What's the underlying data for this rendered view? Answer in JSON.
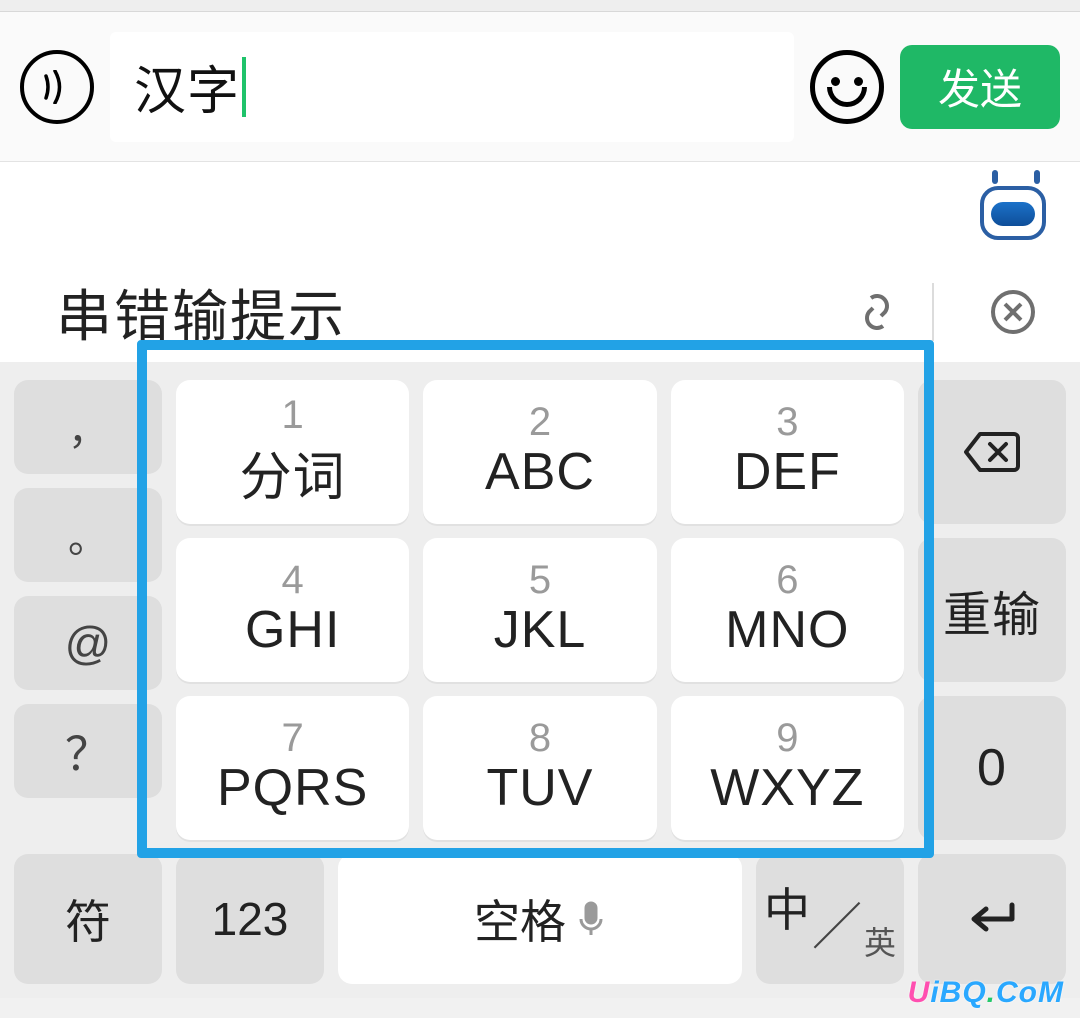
{
  "input": {
    "value": "汉字",
    "send_label": "发送"
  },
  "suggestion": {
    "text": "串错输提示"
  },
  "left_keys": {
    "comma": "，",
    "period": "。",
    "at": "@",
    "question": "？"
  },
  "right_keys": {
    "retype": "重输",
    "zero": "0"
  },
  "t9": [
    {
      "num": "1",
      "label": "分词"
    },
    {
      "num": "2",
      "label": "ABC"
    },
    {
      "num": "3",
      "label": "DEF"
    },
    {
      "num": "4",
      "label": "GHI"
    },
    {
      "num": "5",
      "label": "JKL"
    },
    {
      "num": "6",
      "label": "MNO"
    },
    {
      "num": "7",
      "label": "PQRS"
    },
    {
      "num": "8",
      "label": "TUV"
    },
    {
      "num": "9",
      "label": "WXYZ"
    }
  ],
  "bottom": {
    "symbols": "符",
    "numbers": "123",
    "space": "空格",
    "lang_zh": "中",
    "lang_en": "英"
  },
  "watermark": "UiBQ.CoM"
}
